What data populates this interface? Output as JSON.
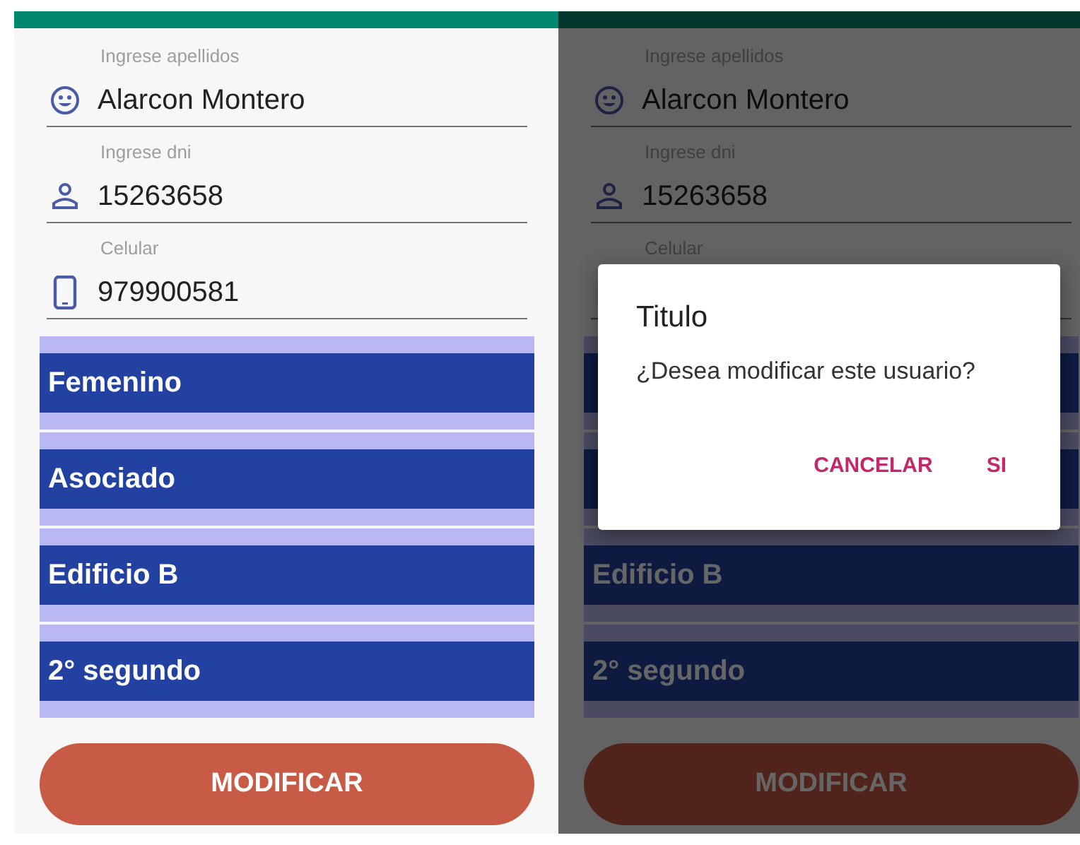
{
  "screens": [
    {
      "fields": [
        {
          "kind": "smiley",
          "label": "Ingrese apellidos",
          "value": "Alarcon Montero"
        },
        {
          "kind": "person",
          "label": "Ingrese dni",
          "value": "15263658"
        },
        {
          "kind": "phone",
          "label": "Celular",
          "value": "979900581"
        }
      ],
      "selects": [
        {
          "kind": "text",
          "text": "Femenino"
        },
        {
          "kind": "text",
          "text": "Asociado"
        },
        {
          "kind": "text",
          "text": "Edificio B"
        },
        {
          "kind": "text",
          "text": "2° segundo"
        }
      ],
      "button": "MODIFICAR"
    },
    {
      "fields": [
        {
          "kind": "smiley",
          "label": "Ingrese apellidos",
          "value": "Alarcon Montero"
        },
        {
          "kind": "person",
          "label": "Ingrese dni",
          "value": "15263658"
        },
        {
          "kind": "phone",
          "label": "Celular"
        }
      ],
      "selects": [
        {
          "kind": "covered"
        },
        {
          "kind": "covered"
        },
        {
          "kind": "text",
          "text": "Edificio B"
        },
        {
          "kind": "text",
          "text": "2° segundo"
        }
      ],
      "button": "MODIFICAR",
      "dialog": {
        "title": "Titulo",
        "message": "¿Desea modificar este usuario?",
        "actions": [
          "CANCELAR",
          "SI"
        ]
      }
    }
  ]
}
